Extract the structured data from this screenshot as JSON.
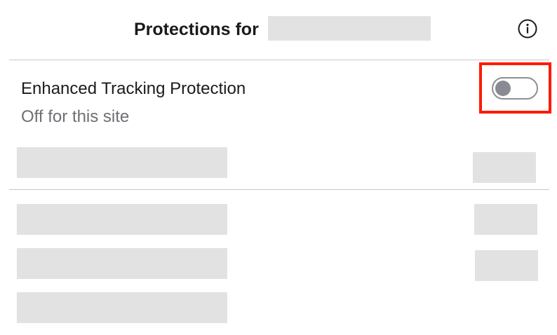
{
  "header": {
    "title": "Protections for",
    "info_icon": "info-icon"
  },
  "tracking_protection": {
    "label": "Enhanced Tracking Protection",
    "status": "Off for this site",
    "toggle_state": "off",
    "highlight_color": "#ff1a00"
  },
  "colors": {
    "redaction": "#e2e2e2",
    "divider": "#c8c8c8",
    "secondary_text": "#6f6f74",
    "toggle_knob": "#8a8a92"
  }
}
